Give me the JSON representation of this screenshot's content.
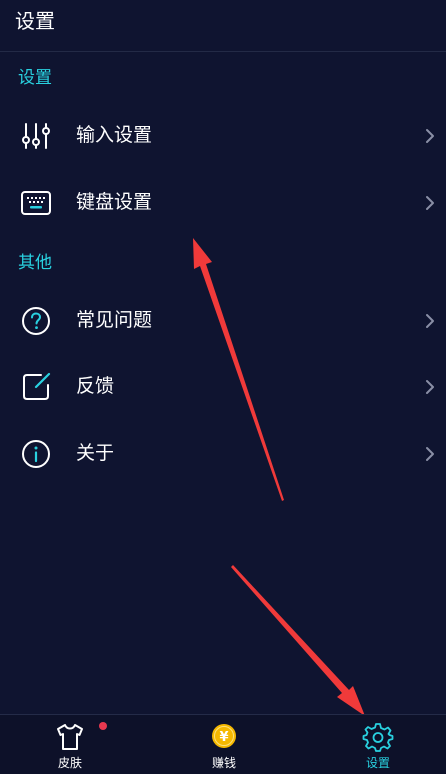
{
  "header": {
    "title": "设置"
  },
  "sections": [
    {
      "label": "设置"
    },
    {
      "label": "其他"
    }
  ],
  "settings_items": [
    {
      "label": "输入设置",
      "icon": "sliders-icon"
    },
    {
      "label": "键盘设置",
      "icon": "keyboard-icon"
    }
  ],
  "other_items": [
    {
      "label": "常见问题",
      "icon": "question-icon"
    },
    {
      "label": "反馈",
      "icon": "edit-icon"
    },
    {
      "label": "关于",
      "icon": "info-icon"
    }
  ],
  "tabs": [
    {
      "label": "皮肤",
      "icon": "shirt-icon",
      "has_badge": true
    },
    {
      "label": "赚钱",
      "icon": "yuan-coin-icon",
      "coin_symbol": "¥"
    },
    {
      "label": "设置",
      "icon": "gear-icon",
      "active": true
    }
  ],
  "colors": {
    "background": "#0f1430",
    "accent": "#29d1e0",
    "badge": "#e8384f",
    "coin": "#f5b800",
    "annotation_arrow": "#f03a3a"
  }
}
